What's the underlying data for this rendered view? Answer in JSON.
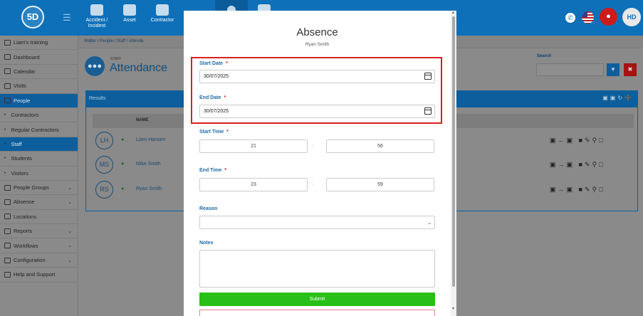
{
  "header": {
    "logo": "5D",
    "nav": [
      {
        "label": "Accident / Incident",
        "icon": "first-aid-icon"
      },
      {
        "label": "Asset",
        "icon": "asset-icon"
      },
      {
        "label": "Contractor",
        "icon": "hardhat-icon"
      }
    ],
    "avatar": "HD"
  },
  "sidebar": {
    "items": [
      {
        "label": "Liam's training",
        "type": "main"
      },
      {
        "label": "Dashboard",
        "type": "main"
      },
      {
        "label": "Calendar",
        "type": "main"
      },
      {
        "label": "Visits",
        "type": "main"
      },
      {
        "label": "People",
        "type": "main",
        "active": true
      },
      {
        "label": "Contractors",
        "type": "sub"
      },
      {
        "label": "Regular Contractors",
        "type": "sub"
      },
      {
        "label": "Staff",
        "type": "sub",
        "active": true
      },
      {
        "label": "Students",
        "type": "sub"
      },
      {
        "label": "Visitors",
        "type": "sub"
      },
      {
        "label": "People Groups",
        "type": "main",
        "chevron": true
      },
      {
        "label": "Absence",
        "type": "main",
        "chevron": true
      },
      {
        "label": "Locations",
        "type": "main"
      },
      {
        "label": "Reports",
        "type": "main",
        "chevron": true
      },
      {
        "label": "Workflows",
        "type": "main",
        "chevron": true
      },
      {
        "label": "Configuration",
        "type": "main",
        "chevron": true
      },
      {
        "label": "Help and Support",
        "type": "main"
      }
    ]
  },
  "breadcrumb": "Walter / People / Staff / Attenda",
  "page": {
    "small_label": "STAFF",
    "title": "Attendance",
    "search_label": "Search"
  },
  "results": {
    "title": "Results",
    "column_name": "NAME",
    "rows": [
      {
        "initials": "LH",
        "name": "Liam Hansen"
      },
      {
        "initials": "MS",
        "name": "Mike Smith"
      },
      {
        "initials": "RS",
        "name": "Ryan Smith"
      }
    ]
  },
  "modal": {
    "title": "Absence",
    "subtitle": "Ryan Smith",
    "start_date_label": "Start Date",
    "start_date": "30/07/2025",
    "end_date_label": "End Date",
    "end_date": "30/07/2025",
    "start_time_label": "Start Time",
    "start_hour": "21",
    "start_minute": "56",
    "end_time_label": "End Time",
    "end_hour": "23",
    "end_minute": "59",
    "colon": ":",
    "required_mark": "*",
    "reason_label": "Reason",
    "reason_value": "",
    "notes_label": "Notes",
    "notes_value": "",
    "submit_label": "Submit"
  },
  "colors": {
    "brand_blue": "#0d70b8",
    "submit_green": "#28c018",
    "required_red": "#d72020"
  }
}
